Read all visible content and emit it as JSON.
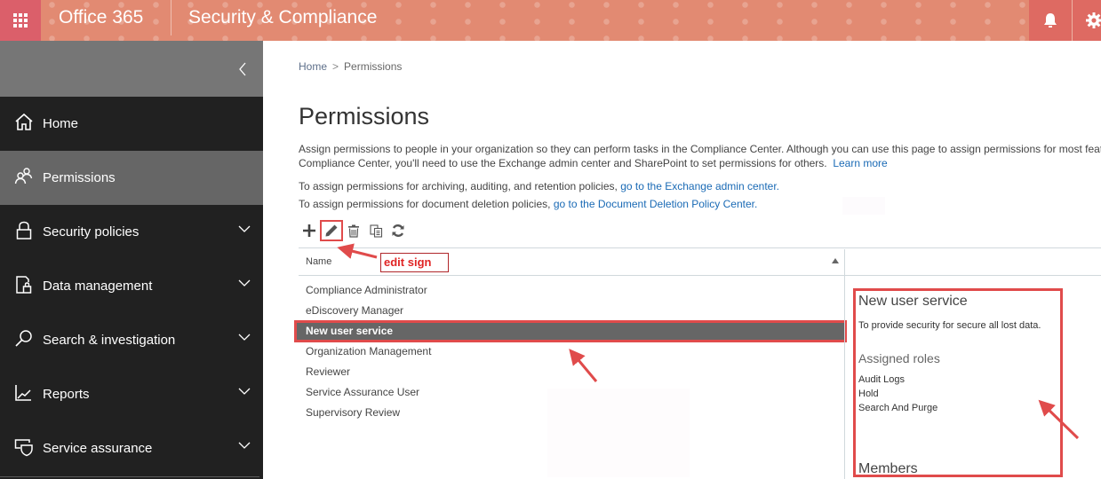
{
  "topbar": {
    "brand": "Office 365",
    "app_title": "Security & Compliance",
    "icons": [
      "app-launcher-icon",
      "bell-icon",
      "gear-icon"
    ]
  },
  "sidebar": {
    "collapse_icon": "chevron-left-icon",
    "items": [
      {
        "label": "Home",
        "icon": "home-icon",
        "expandable": false,
        "active": false
      },
      {
        "label": "Permissions",
        "icon": "people-icon",
        "expandable": false,
        "active": true
      },
      {
        "label": "Security policies",
        "icon": "lock-icon",
        "expandable": true,
        "active": false
      },
      {
        "label": "Data management",
        "icon": "data-lock-icon",
        "expandable": true,
        "active": false
      },
      {
        "label": "Search & investigation",
        "icon": "search-icon",
        "expandable": true,
        "active": false
      },
      {
        "label": "Reports",
        "icon": "chart-icon",
        "expandable": true,
        "active": false
      },
      {
        "label": "Service assurance",
        "icon": "shield-icon",
        "expandable": true,
        "active": false
      }
    ]
  },
  "breadcrumb": {
    "home": "Home",
    "separator": ">",
    "current": "Permissions"
  },
  "page": {
    "title": "Permissions",
    "description_line1": "Assign permissions to people in your organization so they can perform tasks in the Compliance Center. Although you can use this page to assign permissions for most feat",
    "description_line2": "Compliance Center, you'll need to use the Exchange admin center and SharePoint to set permissions for others.",
    "learn_more": "Learn more",
    "archiving_text": "To assign permissions for archiving, auditing, and retention policies,",
    "archiving_link": "go to the Exchange admin center.",
    "deletion_text": "To assign permissions for document deletion policies,",
    "deletion_link": "go to the Document Deletion Policy Center."
  },
  "toolbar": {
    "actions": [
      {
        "name": "add",
        "icon": "plus-icon"
      },
      {
        "name": "edit",
        "icon": "pencil-icon"
      },
      {
        "name": "delete",
        "icon": "trash-icon"
      },
      {
        "name": "copy",
        "icon": "copy-icon"
      },
      {
        "name": "refresh",
        "icon": "refresh-icon"
      }
    ]
  },
  "table": {
    "column_name": "Name",
    "sort": "ascending",
    "rows": [
      "Compliance Administrator",
      "eDiscovery Manager",
      "New user service",
      "Organization Management",
      "Reviewer",
      "Service Assurance User",
      "Supervisory Review"
    ],
    "selected_index": 2
  },
  "detail": {
    "title": "New user service",
    "description": "To provide security for secure all lost data.",
    "assigned_roles_heading": "Assigned roles",
    "roles": [
      "Audit Logs",
      "Hold",
      "Search And Purge"
    ],
    "members_heading": "Members"
  },
  "annotation": {
    "label": "edit sign",
    "color": "#e04b4b"
  },
  "colors": {
    "topbar": "#e28a72",
    "launcher": "#db5f6a",
    "sidebar": "#212121",
    "sidebar_active": "#666666",
    "link": "#1a6ab5"
  }
}
